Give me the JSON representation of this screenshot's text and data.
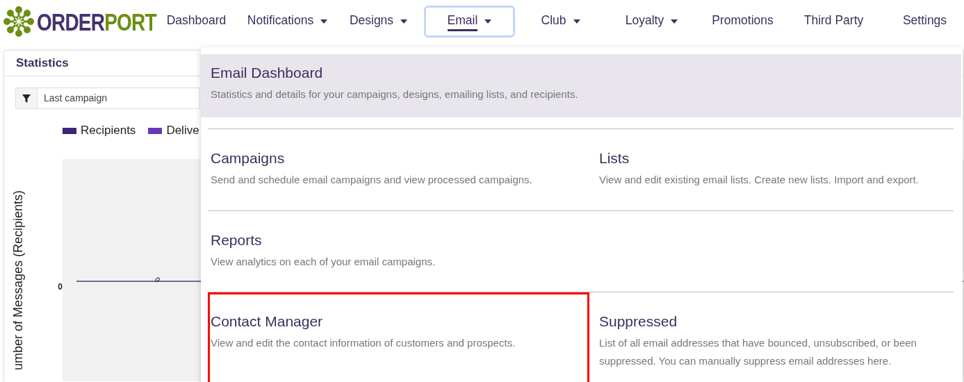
{
  "header": {
    "logo": {
      "part_1": "ORDER",
      "part_2": "PORT"
    },
    "nav": [
      {
        "label": "Dashboard",
        "dropdown": false,
        "selected": false
      },
      {
        "label": "Notifications",
        "dropdown": true,
        "selected": false
      },
      {
        "label": "Designs",
        "dropdown": true,
        "selected": false
      },
      {
        "label": "Email",
        "dropdown": true,
        "selected": true
      },
      {
        "label": "Club",
        "dropdown": true,
        "selected": false
      },
      {
        "label": "Loyalty",
        "dropdown": true,
        "selected": false
      },
      {
        "label": "Promotions",
        "dropdown": false,
        "selected": false
      },
      {
        "label": "Third Party",
        "dropdown": false,
        "selected": false
      },
      {
        "label": "Settings",
        "dropdown": false,
        "selected": false
      }
    ]
  },
  "statistics": {
    "title": "Statistics",
    "filter": {
      "value": "Last campaign"
    },
    "legend": [
      {
        "label": "Recipients",
        "color": "#3b2575"
      },
      {
        "label": "Delive",
        "color": "#6638b8"
      }
    ],
    "chart": {
      "ylabel": "umber of Messages (Recipients)",
      "ytick": "0",
      "data_label": "0"
    }
  },
  "email_menu": {
    "rows": [
      {
        "items": [
          {
            "title": "Email Dashboard",
            "description": "Statistics and details for your campaigns, designs, emailing lists, and recipients.",
            "selected": true,
            "outlined": false
          }
        ]
      },
      {
        "items": [
          {
            "title": "Campaigns",
            "description": "Send and schedule email campaigns and view processed campaigns.",
            "selected": false,
            "outlined": false
          },
          {
            "title": "Lists",
            "description": "View and edit existing email lists. Create new lists. Import and export.",
            "selected": false,
            "outlined": false
          }
        ]
      },
      {
        "items": [
          {
            "title": "Reports",
            "description": "View analytics on each of your email campaigns.",
            "selected": false,
            "outlined": false
          }
        ]
      },
      {
        "items": [
          {
            "title": "Contact Manager",
            "description": "View and edit the contact information of customers and prospects.",
            "selected": false,
            "outlined": true
          },
          {
            "title": "Suppressed",
            "description": "List of all email addresses that have bounced, unsubscribed, or been suppressed. You can manually suppress email addresses here.",
            "selected": false,
            "outlined": false
          }
        ]
      }
    ]
  }
}
